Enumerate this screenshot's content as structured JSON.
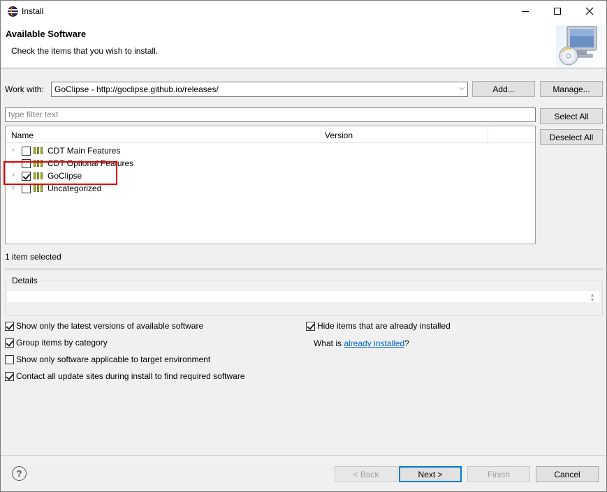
{
  "window": {
    "title": "Install"
  },
  "banner": {
    "title": "Available Software",
    "message": "Check the items that you wish to install."
  },
  "work_with": {
    "label": "Work with:",
    "value": "GoClipse - http://goclipse.github.io/releases/",
    "add_label": "Add...",
    "manage_label": "Manage..."
  },
  "filter": {
    "placeholder": "type filter text"
  },
  "buttons": {
    "select_all": "Select All",
    "deselect_all": "Deselect All"
  },
  "tree": {
    "columns": [
      "Name",
      "Version"
    ],
    "items": [
      {
        "label": "CDT Main Features",
        "checked": false
      },
      {
        "label": "CDT Optional Features",
        "checked": false
      },
      {
        "label": "GoClipse",
        "checked": true
      },
      {
        "label": "Uncategorized",
        "checked": false
      }
    ]
  },
  "status": {
    "selected_count": "1 item selected"
  },
  "details": {
    "label": "Details"
  },
  "options": {
    "latest_versions": {
      "label": "Show only the latest versions of available software",
      "checked": true
    },
    "group_by_category": {
      "label": "Group items by category",
      "checked": true
    },
    "applicable_only": {
      "label": "Show only software applicable to target environment",
      "checked": false
    },
    "contact_all_sites": {
      "label": "Contact all update sites during install to find required software",
      "checked": true
    },
    "hide_installed": {
      "label": "Hide items that are already installed",
      "checked": true
    },
    "what_is_prefix": "What is ",
    "what_is_link": "already installed",
    "what_is_suffix": "?"
  },
  "footer": {
    "help": "?",
    "back": "< Back",
    "next": "Next >",
    "finish": "Finish",
    "cancel": "Cancel"
  },
  "colors": {
    "highlight_box": "#e00000",
    "link": "#0066cc",
    "default_button_border": "#0078d7"
  }
}
